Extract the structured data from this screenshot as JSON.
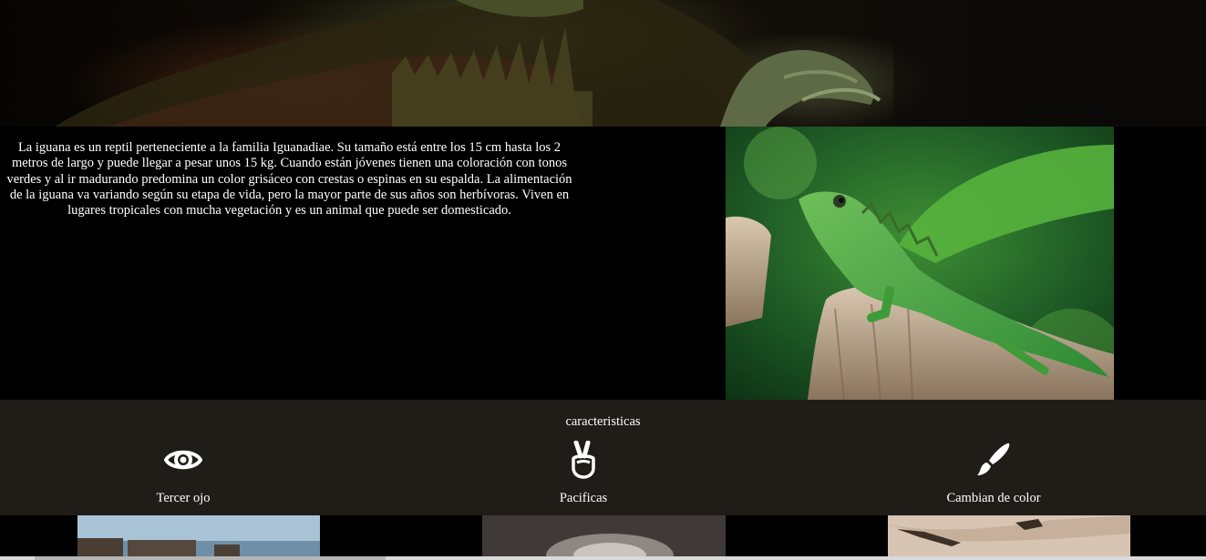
{
  "hero": {
    "image": "iguana-closeup-dark"
  },
  "intro": {
    "paragraph": "La iguana es un reptil perteneciente a la familia Iguanadiae. Su tamaño está entre los 15 cm hasta los 2 metros de largo y puede llegar a pesar unos 15 kg. Cuando están jóvenes tienen una coloración con tonos verdes y al ir madurando predomina un color grisáceo con crestas o espinas en su espalda. La alimentación de la iguana va variando según su etapa de vida, pero la mayor parte de sus años son herbívoras. Viven en lugares tropicales con mucha vegetación y es un animal que puede ser domesticado.",
    "image": "green-lizard-on-stump"
  },
  "features": {
    "title": "caracteristicas",
    "items": [
      {
        "label": "Tercer ojo",
        "icon": "eye-icon"
      },
      {
        "label": "Pacificas",
        "icon": "peace-hand-icon"
      },
      {
        "label": "Cambian de color",
        "icon": "paintbrush-icon"
      }
    ]
  },
  "thumbnails": [
    "rocks-shore-photo",
    "iguana-eye-photo",
    "lizards-sand-photo"
  ],
  "colors": {
    "background": "#000000",
    "features_band": "#201c18",
    "text": "#ffffff"
  }
}
